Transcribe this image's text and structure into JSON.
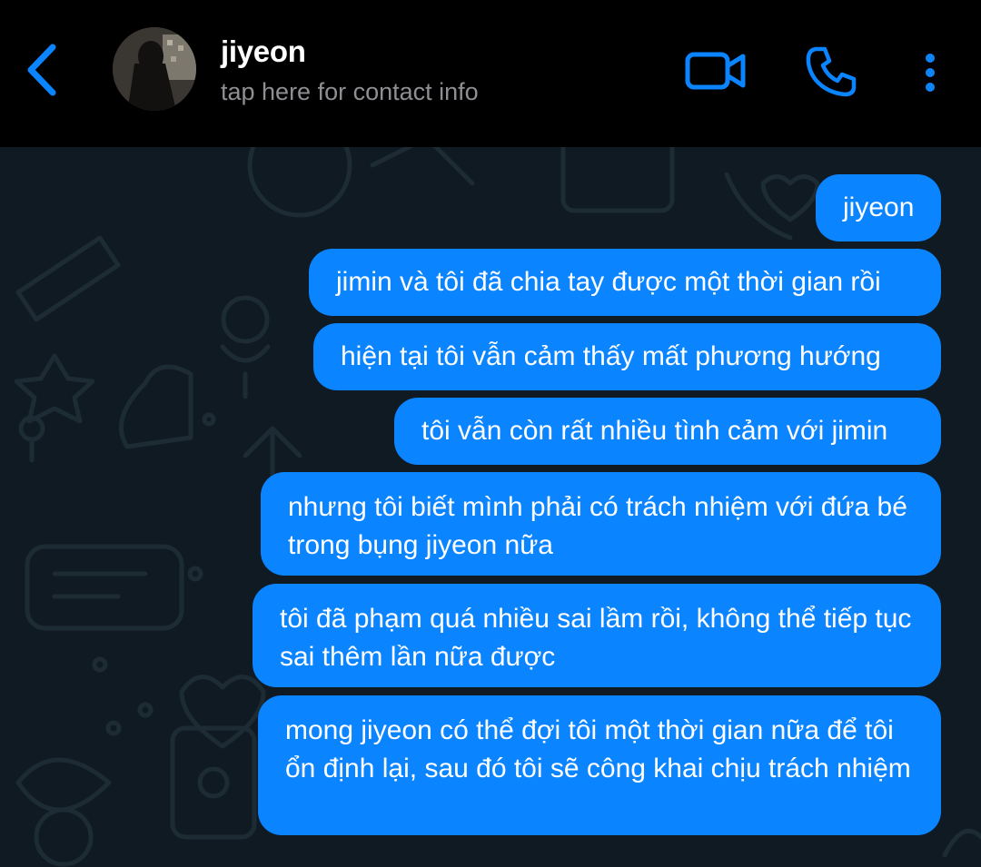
{
  "header": {
    "contact_name": "jiyeon",
    "subtitle": "tap here for contact info",
    "back_icon": "chevron-left-icon",
    "video_icon": "video-camera-icon",
    "call_icon": "phone-icon",
    "menu_icon": "more-vertical-icon",
    "accent_color": "#0a84ff"
  },
  "messages": [
    {
      "text": "jiyeon",
      "direction": "outgoing"
    },
    {
      "text": "jimin và tôi đã chia tay được một thời gian rồi",
      "direction": "outgoing"
    },
    {
      "text": "hiện tại tôi vẫn cảm thấy mất phương hướng",
      "direction": "outgoing"
    },
    {
      "text": "tôi vẫn còn rất nhiều tình cảm với jimin",
      "direction": "outgoing"
    },
    {
      "text": "nhưng tôi biết mình phải có trách nhiệm với đứa bé trong bụng jiyeon nữa",
      "direction": "outgoing"
    },
    {
      "text": "tôi đã phạm quá nhiều sai lầm rồi, không thể tiếp tục sai thêm lần nữa được",
      "direction": "outgoing"
    },
    {
      "text": "mong jiyeon có thể đợi tôi một thời gian nữa để tôi ổn định lại, sau đó tôi sẽ công khai chịu trách nhiệm",
      "direction": "outgoing"
    }
  ],
  "colors": {
    "header_bg": "#000000",
    "chat_bg": "#0f1a22",
    "bubble_bg": "#0a84ff",
    "bubble_text": "#ffffff"
  }
}
